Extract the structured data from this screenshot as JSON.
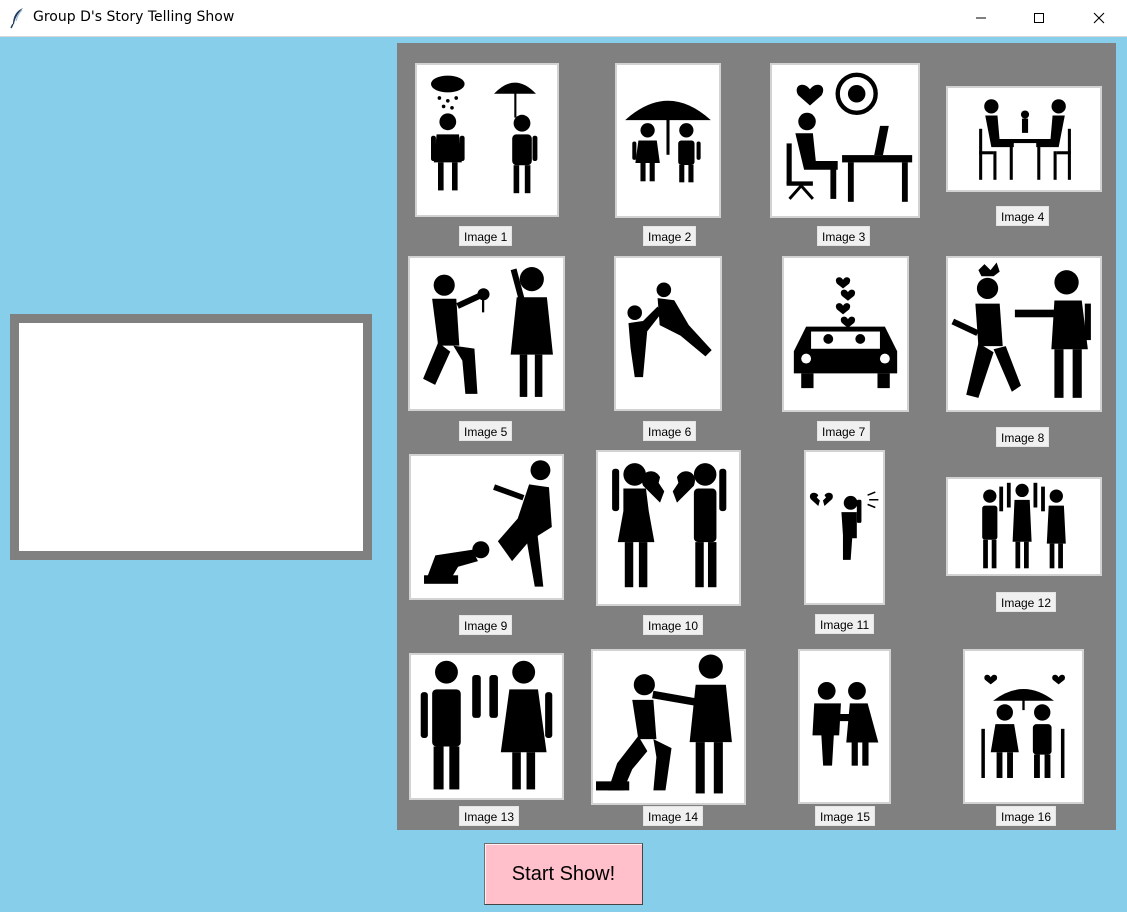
{
  "window": {
    "title": "Group D's Story Telling Show",
    "icon": "feather-icon"
  },
  "gallery": {
    "images": [
      {
        "label": "Image 1",
        "icon": "rain-umbrella-couple-icon"
      },
      {
        "label": "Image 2",
        "icon": "shared-umbrella-couple-icon"
      },
      {
        "label": "Image 3",
        "icon": "desk-thinking-of-love-icon"
      },
      {
        "label": "Image 4",
        "icon": "dinner-date-icon"
      },
      {
        "label": "Image 5",
        "icon": "proposal-flower-icon"
      },
      {
        "label": "Image 6",
        "icon": "lift-partner-icon"
      },
      {
        "label": "Image 7",
        "icon": "car-couple-hearts-icon"
      },
      {
        "label": "Image 8",
        "icon": "argument-icon"
      },
      {
        "label": "Image 9",
        "icon": "kneeling-plea-icon"
      },
      {
        "label": "Image 10",
        "icon": "broken-heart-couple-icon"
      },
      {
        "label": "Image 11",
        "icon": "crying-broken-heart-icon"
      },
      {
        "label": "Image 12",
        "icon": "family-waving-icon"
      },
      {
        "label": "Image 13",
        "icon": "high-five-couple-icon"
      },
      {
        "label": "Image 14",
        "icon": "kneeling-hand-hold-icon"
      },
      {
        "label": "Image 15",
        "icon": "hugging-couple-icon"
      },
      {
        "label": "Image 16",
        "icon": "elderly-couple-umbrella-icon"
      }
    ]
  },
  "controls": {
    "start_label": "Start Show!"
  },
  "colors": {
    "background": "#87ceeb",
    "gallery": "#808080",
    "start_button": "#ffc0cb"
  }
}
